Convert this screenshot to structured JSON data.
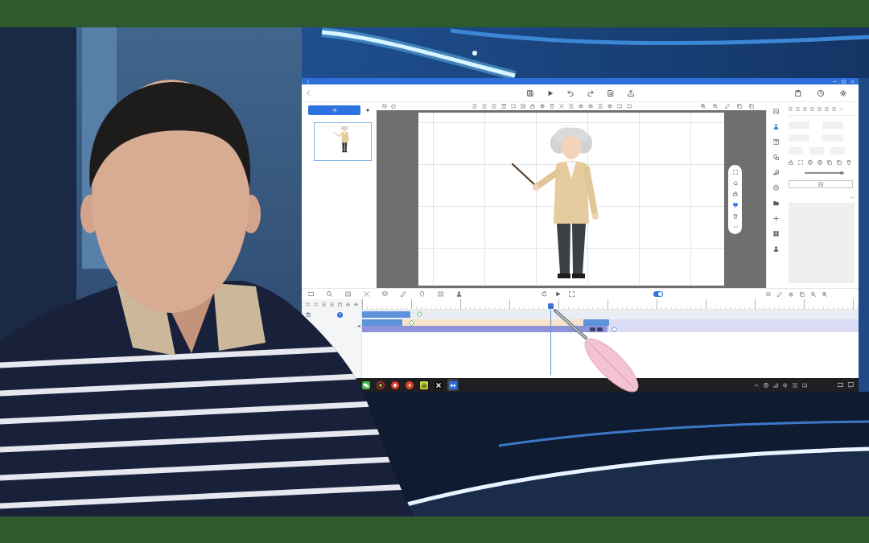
{
  "app_window": {
    "side_tabs": [
      {
        "kind": "image",
        "selected": false
      },
      {
        "kind": "person",
        "selected": true
      },
      {
        "kind": "text",
        "selected": false
      },
      {
        "kind": "shape",
        "selected": false
      },
      {
        "kind": "music",
        "selected": false
      },
      {
        "kind": "effect",
        "selected": false
      },
      {
        "kind": "folder",
        "selected": false
      },
      {
        "kind": "add",
        "selected": false
      },
      {
        "kind": "grid",
        "selected": false
      },
      {
        "kind": "user",
        "selected": false
      }
    ],
    "canvas_tools": [
      {
        "kind": "fit",
        "selected": false
      },
      {
        "kind": "erase",
        "selected": false
      },
      {
        "kind": "lock",
        "selected": false
      },
      {
        "kind": "screen",
        "selected": true
      },
      {
        "kind": "delete",
        "selected": false
      },
      {
        "kind": "more",
        "selected": false
      }
    ],
    "properties": {
      "opacity_slider": {
        "level": 0.92
      }
    },
    "timeline": {
      "loop_toggle": {
        "on": true
      },
      "playhead": {
        "level": 0.38
      }
    }
  },
  "taskbar": {
    "apps": [
      {
        "kind": "chat",
        "selected": false
      },
      {
        "kind": "browser",
        "selected": false
      },
      {
        "kind": "recorder",
        "selected": false
      },
      {
        "kind": "media",
        "selected": false
      },
      {
        "kind": "notes",
        "selected": false
      },
      {
        "kind": "editor",
        "selected": false
      },
      {
        "kind": "studio",
        "selected": true
      }
    ]
  }
}
